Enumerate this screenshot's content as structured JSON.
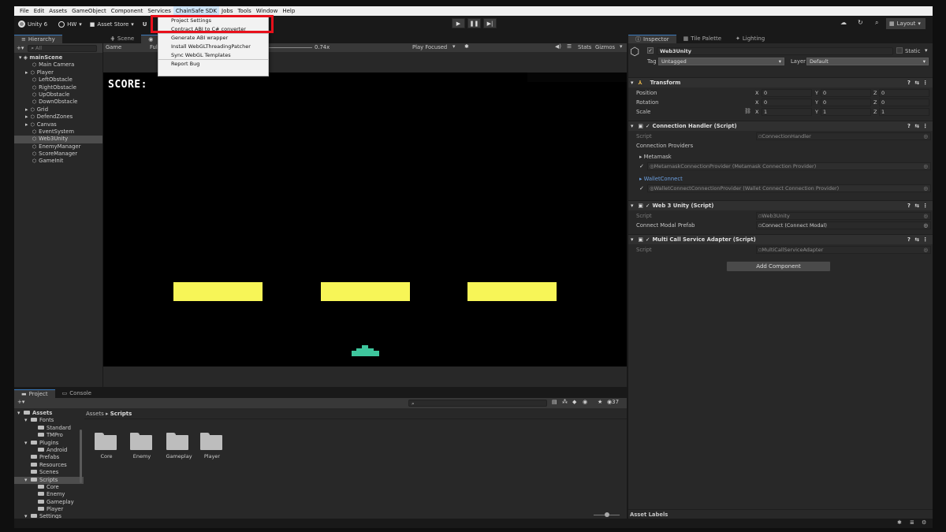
{
  "menubar": {
    "items": [
      "File",
      "Edit",
      "Assets",
      "GameObject",
      "Component",
      "Services",
      "ChainSafe SDK",
      "Jobs",
      "Tools",
      "Window",
      "Help"
    ],
    "active": "ChainSafe SDK"
  },
  "toolbar": {
    "unity_label": "Unity 6",
    "account": "HW",
    "asset_store": "Asset Store",
    "layout": "Layout",
    "partial_u": "U"
  },
  "dropdown": {
    "items": [
      "Project Settings",
      "Contract ABI to C# converter",
      "Generate ABI wrapper",
      "Install WebGLThreadingPatcher",
      "Sync WebGL Templates",
      "Report Bug"
    ]
  },
  "hierarchy": {
    "tab": "Hierarchy",
    "search_placeholder": "All",
    "scene": "mainScene",
    "items": [
      "Main Camera",
      "Player",
      "LeftObstacle",
      "RightObstacle",
      "UpObstacle",
      "DownObstacle",
      "Grid",
      "DefendZones",
      "Canvas",
      "EventSystem",
      "Web3Unity",
      "EnemyManager",
      "ScoreManager",
      "GameInit"
    ],
    "selected": "Web3Unity"
  },
  "scene_tabs": {
    "scene": "Scene",
    "game": "Game"
  },
  "game_toolbar": {
    "display": "Game",
    "resolution": "Full",
    "scale": "0.74x",
    "play_mode": "Play Focused",
    "stats": "Stats",
    "gizmos": "Gizmos"
  },
  "game": {
    "score_label": "SCORE:",
    "colors": {
      "background": "#000000",
      "obstacle": "#f7f557",
      "player": "#3ec69d"
    }
  },
  "inspector": {
    "tabs": [
      "Inspector",
      "Tile Palette",
      "Lighting"
    ],
    "object_name": "Web3Unity",
    "static_label": "Static",
    "tag_label": "Tag",
    "tag_value": "Untagged",
    "layer_label": "Layer",
    "layer_value": "Default",
    "transform": {
      "title": "Transform",
      "position": {
        "label": "Position",
        "x": "0",
        "y": "0",
        "z": "0"
      },
      "rotation": {
        "label": "Rotation",
        "x": "0",
        "y": "0",
        "z": "0"
      },
      "scale": {
        "label": "Scale",
        "x": "1",
        "y": "1",
        "z": "1"
      }
    },
    "connection_handler": {
      "title": "Connection Handler (Script)",
      "script_label": "Script",
      "script_value": "ConnectionHandler",
      "providers_label": "Connection Providers",
      "metamask": "Metamask",
      "metamask_value": "MetamaskConnectionProvider (Metamask Connection Provider)",
      "walletconnect": "WalletConnect",
      "walletconnect_value": "WalletConnectConnectionProvider (Wallet Connect Connection Provider)"
    },
    "web3unity": {
      "title": "Web 3 Unity (Script)",
      "script_label": "Script",
      "script_value": "Web3Unity",
      "modal_label": "Connect Modal Prefab",
      "modal_value": "Connect (Connect Modal)"
    },
    "multicall": {
      "title": "Multi Call Service Adapter (Script)",
      "script_label": "Script",
      "script_value": "MultiCallServiceAdapter"
    },
    "add_component": "Add Component",
    "asset_labels": "Asset Labels"
  },
  "project": {
    "tabs": [
      "Project",
      "Console"
    ],
    "count": "37",
    "breadcrumb": [
      "Assets",
      "Scripts"
    ],
    "tree": [
      {
        "label": "Assets",
        "level": 0
      },
      {
        "label": "Fonts",
        "level": 1
      },
      {
        "label": "Standard",
        "level": 2
      },
      {
        "label": "TMPro",
        "level": 2
      },
      {
        "label": "Plugins",
        "level": 1
      },
      {
        "label": "Android",
        "level": 2
      },
      {
        "label": "Prefabs",
        "level": 1
      },
      {
        "label": "Resources",
        "level": 1
      },
      {
        "label": "Scenes",
        "level": 1
      },
      {
        "label": "Scripts",
        "level": 1
      },
      {
        "label": "Core",
        "level": 2
      },
      {
        "label": "Enemy",
        "level": 2
      },
      {
        "label": "Gameplay",
        "level": 2
      },
      {
        "label": "Player",
        "level": 2
      },
      {
        "label": "Settings",
        "level": 1
      }
    ],
    "folders": [
      "Core",
      "Enemy",
      "Gameplay",
      "Player"
    ]
  }
}
